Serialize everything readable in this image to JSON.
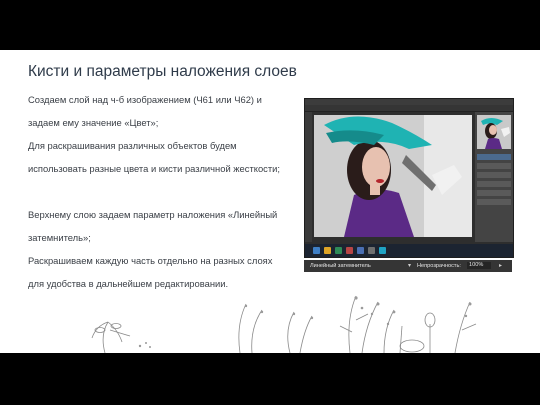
{
  "slide": {
    "title": "Кисти и параметры наложения слоев",
    "paragraphs": [
      "Создаем слой над ч-б изображением (Ч61 или Ч62) и задаем ему значение «Цвет»;",
      "Для раскрашивания различных объектов будем использовать разные цвета и кисти различной жесткости;",
      "Верхнему слою задаем параметр наложения «Линейный затемнитель»;",
      "Раскрашиваем каждую часть отдельно на разных слоях для удобства в дальнейшем редактировании."
    ]
  },
  "screenshot": {
    "blend_mode": "Линейный затемнитель",
    "opacity_label": "Непрозрачность:",
    "opacity_value": "100%"
  },
  "colors": {
    "background": "#000000",
    "slide": "#ffffff",
    "title": "#2f3b4a",
    "text": "#3a3f46",
    "hat": "#1fb3b3",
    "dress": "#5b2a86"
  },
  "icons": {
    "decor": "sketch-plants"
  }
}
